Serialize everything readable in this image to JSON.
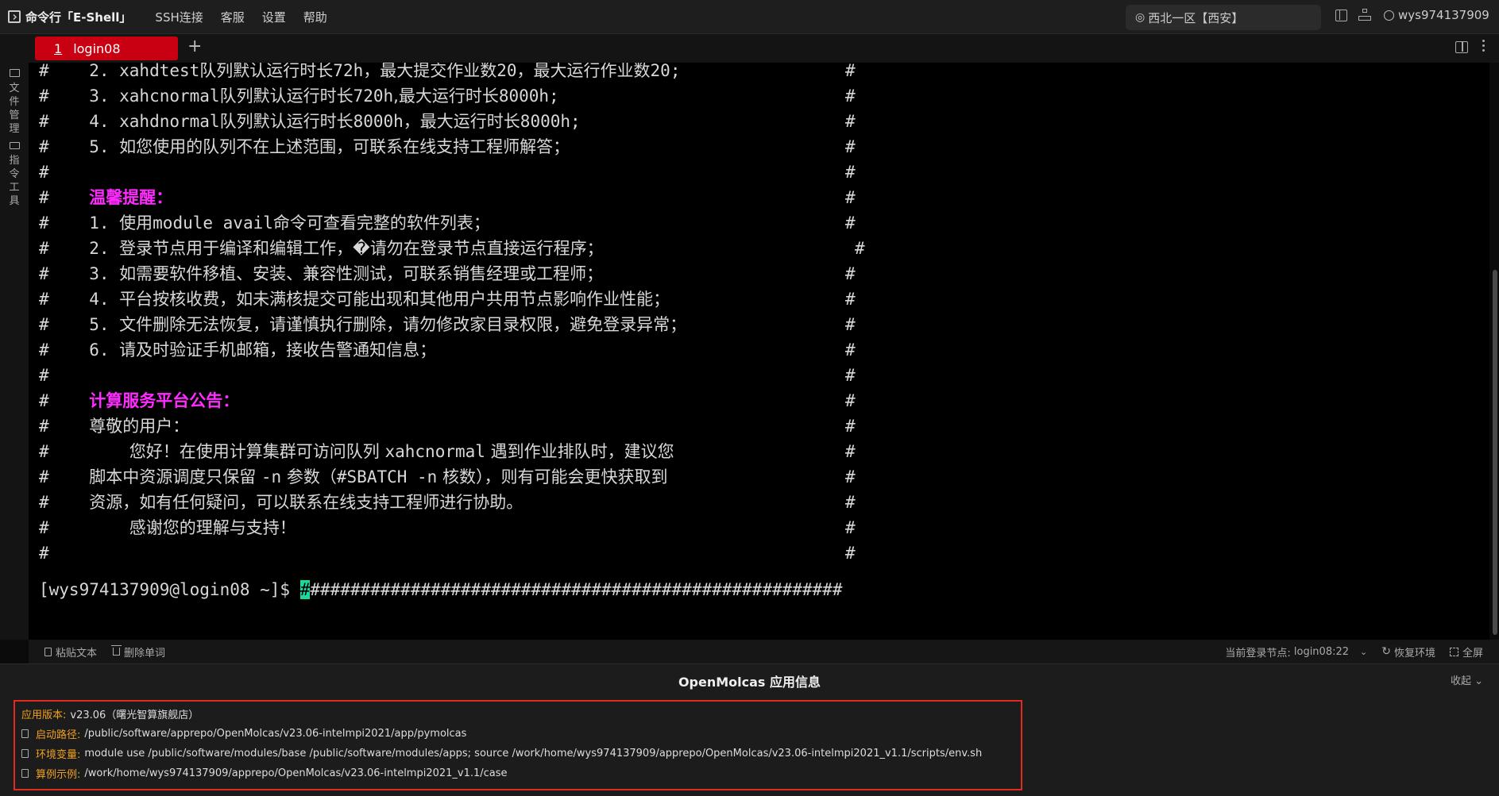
{
  "app": {
    "title": "命令行「E-Shell」"
  },
  "menu": [
    "SSH连接",
    "客服",
    "设置",
    "帮助"
  ],
  "region": {
    "label": "西北一区【西安】"
  },
  "user": {
    "name": "wys974137909"
  },
  "tabs": [
    {
      "index": "1",
      "label": "login08"
    }
  ],
  "tab_add": "+",
  "sidebar": {
    "items": [
      {
        "label": [
          "文",
          "件",
          "管",
          "理"
        ]
      },
      {
        "label": [
          "指",
          "令",
          "工",
          "具"
        ]
      }
    ]
  },
  "terminal": {
    "lines": [
      {
        "pre": "#    2. xahdtest",
        "cn": "队列默认运行时长",
        "rest": "72h",
        "cn2": "，最大提交作业数",
        "r2": "20",
        "cn3": "，最大运行作业数",
        "r3": "20;",
        "hash": "#"
      },
      {
        "pre": "#    3. xahcnormal",
        "cn": "队列默认运行时长",
        "rest": "720h",
        "cn2": ",最大运行时长",
        "r2": "8000h;",
        "cn3": "",
        "r3": "",
        "hash": "#"
      },
      {
        "pre": "#    4. xahdnormal",
        "cn": "队列默认运行时长",
        "rest": "8000h",
        "cn2": "，最大运行时长",
        "r2": "8000h;",
        "cn3": "",
        "r3": "",
        "hash": "#"
      },
      {
        "pre": "#    5. ",
        "cn": "如您使用的队列不在上述范围，可联系在线支持工程师解答；",
        "rest": "",
        "cn2": "",
        "r2": "",
        "cn3": "",
        "r3": "",
        "hash": "#"
      },
      {
        "pre": "#",
        "cn": "",
        "rest": "",
        "cn2": "",
        "r2": "",
        "cn3": "",
        "r3": "",
        "hash": "#"
      },
      {
        "pre": "#    ",
        "hdr": "温馨提醒：",
        "hash": "#"
      },
      {
        "pre": "#    1. ",
        "cn": "使用",
        "rest": "module avail",
        "cn2": "命令可查看完整的软件列表；",
        "r2": "",
        "cn3": "",
        "r3": "",
        "hash": "#"
      },
      {
        "pre": "#    2. ",
        "cn": "登录节点用于编译和编辑工作，�请勿在登录节点直接运行程序；",
        "rest": "",
        "cn2": "",
        "r2": "",
        "cn3": "",
        "r3": "",
        "hash": "#"
      },
      {
        "pre": "#    3. ",
        "cn": "如需要软件移植、安装、兼容性测试，可联系销售经理或工程师；",
        "rest": "",
        "cn2": "",
        "r2": "",
        "cn3": "",
        "r3": "",
        "hash": "#"
      },
      {
        "pre": "#    4. ",
        "cn": "平台按核收费，如未满核提交可能出现和其他用户共用节点影响作业性能；",
        "rest": "",
        "cn2": "",
        "r2": "",
        "cn3": "",
        "r3": "",
        "hash": "#"
      },
      {
        "pre": "#    5. ",
        "cn": "文件删除无法恢复，请谨慎执行删除，请勿修改家目录权限，避免登录异常；",
        "rest": "",
        "cn2": "",
        "r2": "",
        "cn3": "",
        "r3": "",
        "hash": "#"
      },
      {
        "pre": "#    6. ",
        "cn": "请及时验证手机邮箱，接收告警通知信息；",
        "rest": "",
        "cn2": "",
        "r2": "",
        "cn3": "",
        "r3": "",
        "hash": "#"
      },
      {
        "pre": "#",
        "cn": "",
        "rest": "",
        "cn2": "",
        "r2": "",
        "cn3": "",
        "r3": "",
        "hash": "#"
      },
      {
        "pre": "#    ",
        "hdr": "计算服务平台公告：",
        "hash": "#"
      },
      {
        "pre": "#    ",
        "cn": "尊敬的用户：",
        "rest": "",
        "cn2": "",
        "r2": "",
        "cn3": "",
        "r3": "",
        "hash": "#"
      },
      {
        "pre": "#        ",
        "cn": "您好！在使用计算集群可访问队列 ",
        "rest": "xahcnormal",
        "cn2": " 遇到作业排队时，建议您",
        "r2": "",
        "cn3": "",
        "r3": "",
        "hash": "#"
      },
      {
        "pre": "#    ",
        "cn": "脚本中资源调度只保留 ",
        "rest": "-n",
        "cn2": " 参数（",
        "r2": "#SBATCH -n",
        "cn3": " 核数），则有可能会更快获取到",
        "r3": "",
        "hash": "#"
      },
      {
        "pre": "#    ",
        "cn": "资源，如有任何疑问，可以联系在线支持工程师进行协助。",
        "rest": "",
        "cn2": "",
        "r2": "",
        "cn3": "",
        "r3": "",
        "hash": "#"
      },
      {
        "pre": "#        ",
        "cn": "感谢您的理解与支持！",
        "rest": "",
        "cn2": "",
        "r2": "",
        "cn3": "",
        "r3": "",
        "hash": "#"
      },
      {
        "pre": "#",
        "cn": "",
        "rest": "",
        "cn2": "",
        "r2": "",
        "cn3": "",
        "r3": "",
        "hash": "#"
      }
    ],
    "prompt": "[wys974137909@login08 ~]$ ",
    "cursor_char": "#",
    "after_cursor": "#####################################################"
  },
  "toolbar": {
    "paste": "粘贴文本",
    "delete_word": "删除单词",
    "node_label": "当前登录节点:",
    "node_value": "login08:22",
    "restore": "恢复环境",
    "fullscreen": "全屏"
  },
  "info": {
    "title": "OpenMolcas 应用信息",
    "collapse": "收起",
    "rows": [
      {
        "label": "应用版本:",
        "value": "v23.06（曙光智算旗舰店）",
        "copy": false
      },
      {
        "label": "启动路径:",
        "value": "/public/software/apprepo/OpenMolcas/v23.06-intelmpi2021/app/pymolcas",
        "copy": true
      },
      {
        "label": "环境变量:",
        "value": "module use /public/software/modules/base /public/software/modules/apps; source /work/home/wys974137909/apprepo/OpenMolcas/v23.06-intelmpi2021_v1.1/scripts/env.sh",
        "copy": true
      },
      {
        "label": "算例示例:",
        "value": "/work/home/wys974137909/apprepo/OpenMolcas/v23.06-intelmpi2021_v1.1/case",
        "copy": true
      }
    ],
    "highlight_color": "#e42a20",
    "label_color": "#f0a020"
  },
  "colors": {
    "tab_active": "#c80012",
    "heading_magenta": "#ff2bff",
    "cursor": "#19d9a0"
  }
}
